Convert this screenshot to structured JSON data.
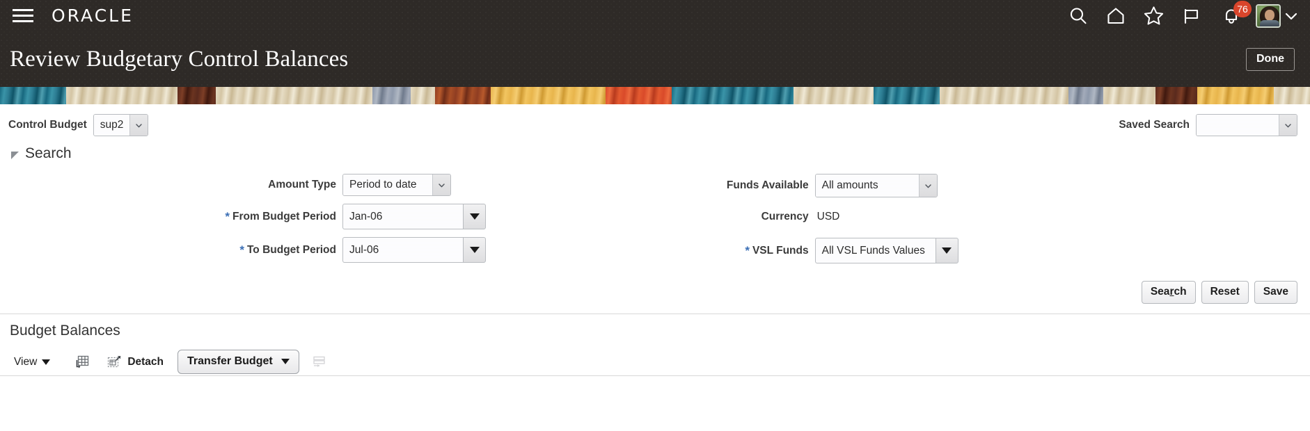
{
  "header": {
    "menu_icon": "hamburger-menu-icon",
    "logo_text": "ORACLE",
    "icons": [
      {
        "name": "search-icon",
        "label": "Search"
      },
      {
        "name": "home-icon",
        "label": "Home"
      },
      {
        "name": "favorites-star-icon",
        "label": "Favorites"
      },
      {
        "name": "flag-icon",
        "label": "Watchlist"
      },
      {
        "name": "notifications-bell-icon",
        "label": "Notifications"
      }
    ],
    "notification_count": "76",
    "notification_badge_color": "#d9452b",
    "avatar_name": "user-avatar",
    "user_chevron": "chevron-down-icon",
    "page_title": "Review Budgetary Control Balances",
    "done_label": "Done",
    "background_color": "#2e2a27"
  },
  "banner": {
    "name": "decorative-banner-strip",
    "colors": [
      "#17687f",
      "#e6dcc4",
      "#8f3d22",
      "#e8b54c",
      "#d94a2a",
      "#8e99ab",
      "#5a2a1d"
    ]
  },
  "control_budget": {
    "label": "Control Budget",
    "value": "sup2"
  },
  "saved_search": {
    "label": "Saved Search",
    "value": ""
  },
  "search_panel": {
    "title": "Search",
    "expanded": true,
    "fields_left": [
      {
        "label": "Amount Type",
        "value": "Period to date",
        "required": false,
        "type": "select"
      },
      {
        "label": "From Budget Period",
        "value": "Jan-06",
        "required": true,
        "type": "lov"
      },
      {
        "label": "To Budget Period",
        "value": "Jul-06",
        "required": true,
        "type": "lov"
      }
    ],
    "fields_right": [
      {
        "label": "Funds Available",
        "value": "All amounts",
        "required": false,
        "type": "select"
      },
      {
        "label": "Currency",
        "value": "USD",
        "required": false,
        "type": "readonly"
      },
      {
        "label": "VSL Funds",
        "value": "All VSL Funds Values",
        "required": true,
        "type": "lov"
      }
    ],
    "buttons": {
      "search": {
        "label": "Search",
        "accesskey_prefix": "Sea",
        "accesskey_char": "r",
        "accesskey_suffix": "ch"
      },
      "reset": {
        "label": "Reset"
      },
      "save": {
        "label": "Save"
      }
    },
    "required_marker": "*",
    "required_color": "#3b6fb5"
  },
  "budget_balances": {
    "title": "Budget Balances",
    "toolbar": {
      "view_label": "View",
      "view_caret": "caret-down-icon",
      "freeze_icon": "freeze-columns-icon",
      "detach_icon": "detach-icon",
      "detach_label": "Detach",
      "transfer_label": "Transfer Budget",
      "transfer_caret": "caret-down-icon",
      "export_icon": "export-to-excel-icon",
      "export_disabled": true
    }
  }
}
